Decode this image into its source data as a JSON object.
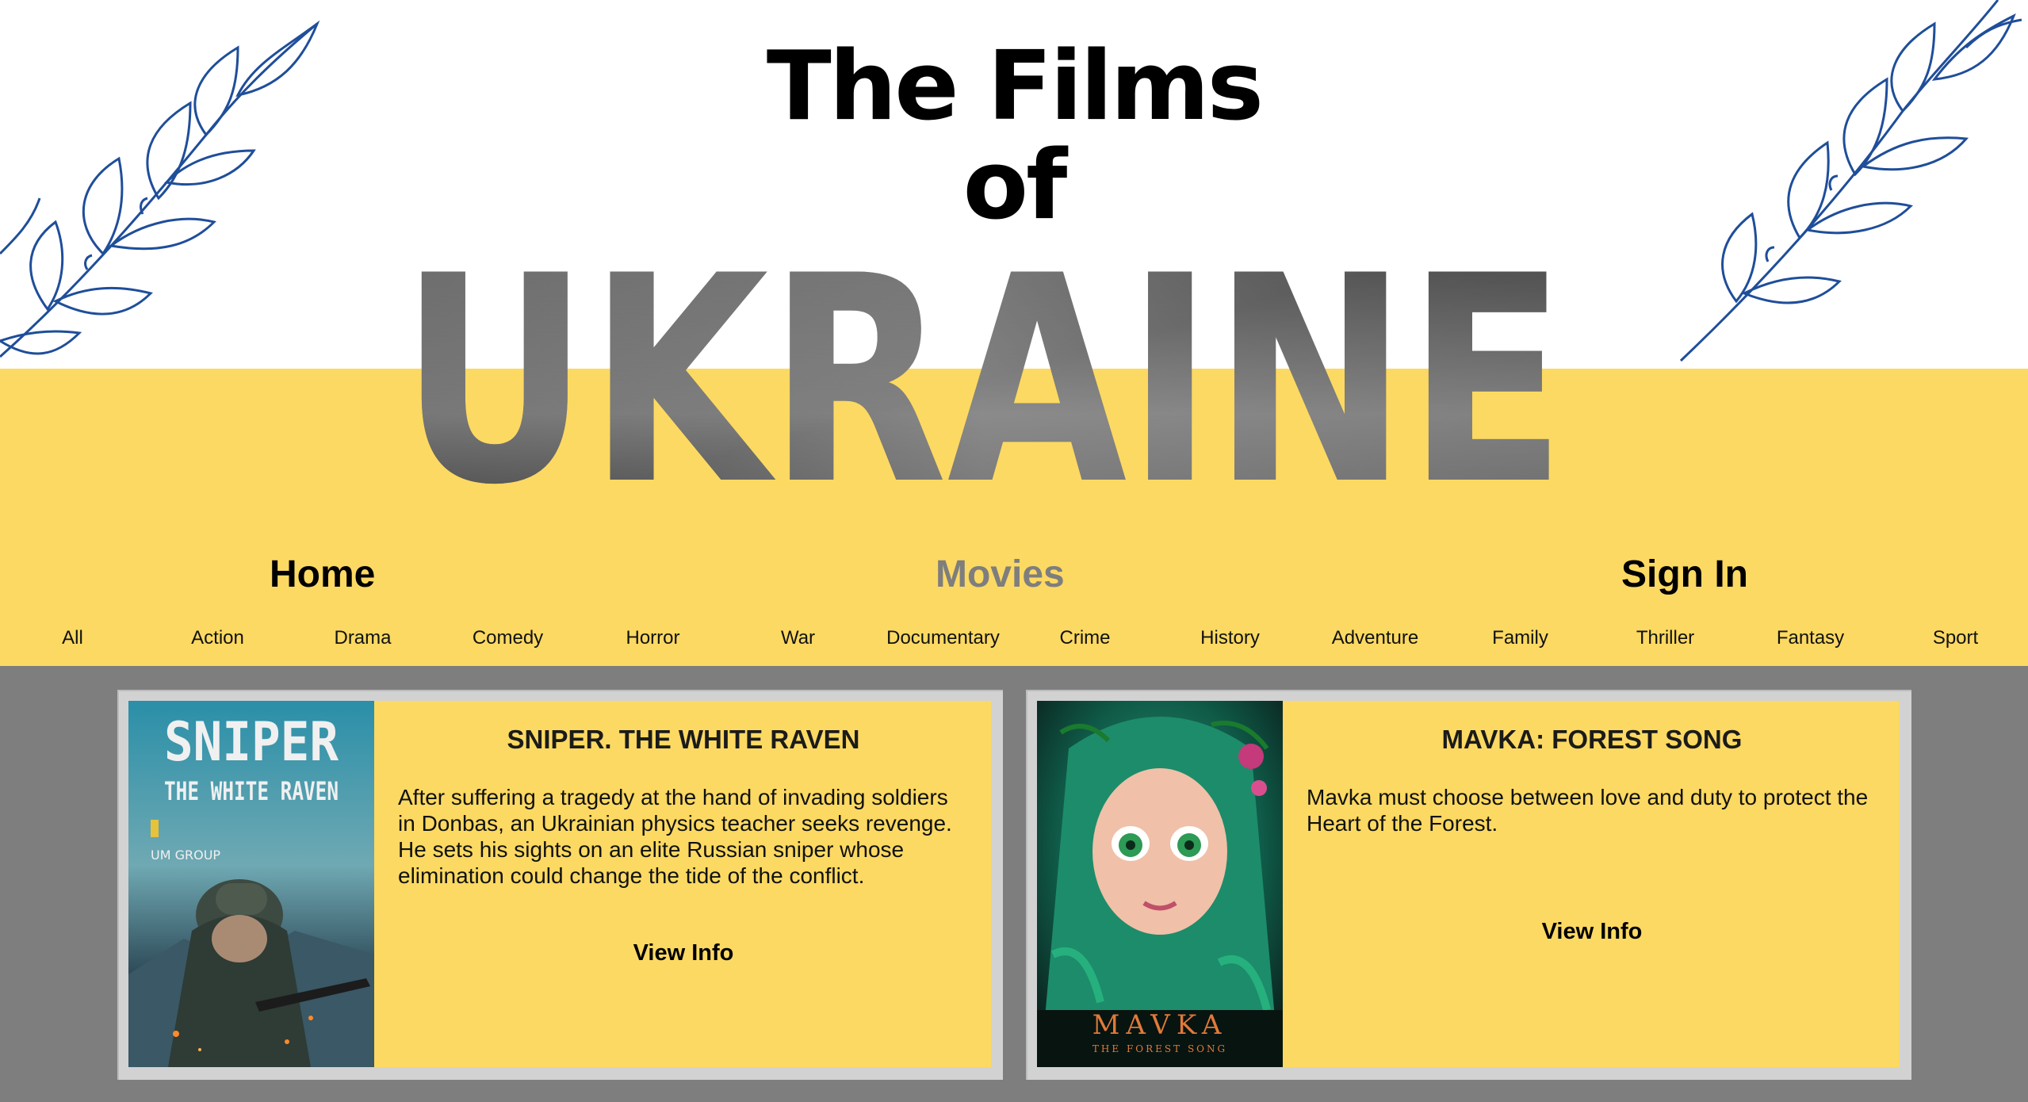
{
  "header": {
    "title_line1": "The Films",
    "title_line2": "of",
    "title_word": "UKRAINE"
  },
  "nav": {
    "home": "Home",
    "movies": "Movies",
    "sign_in": "Sign In",
    "active": "movies"
  },
  "genres": [
    "All",
    "Action",
    "Drama",
    "Comedy",
    "Horror",
    "War",
    "Documentary",
    "Crime",
    "History",
    "Adventure",
    "Family",
    "Thriller",
    "Fantasy",
    "Sport"
  ],
  "films": [
    {
      "title": "SNIPER. THE WHITE RAVEN",
      "description": "After suffering a tragedy at the hand of invading soldiers in Donbas, an Ukrainian physics teacher seeks revenge. He sets his sights on an elite Russian sniper whose elimination could change the tide of the conflict.",
      "action": "View Info",
      "poster_line1": "SNIPER",
      "poster_line2": "THE WHITE RAVEN",
      "poster_logo": "UM GROUP"
    },
    {
      "title": "MAVKA: FOREST SONG",
      "description": "Mavka must choose between love and duty to protect the Heart of the Forest.",
      "action": "View Info",
      "poster_line1": "MAVKA",
      "poster_line2": "THE FOREST SONG"
    }
  ],
  "colors": {
    "yellow": "#fcd962",
    "gray": "#7e7e7e",
    "vine_blue": "#1f4e9a",
    "nav_active": "#7e7e7e"
  }
}
